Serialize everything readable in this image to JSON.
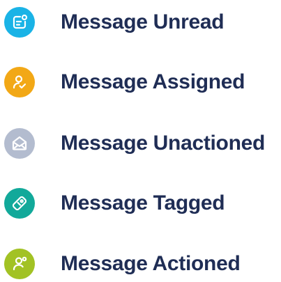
{
  "legend": {
    "items": [
      {
        "label": "Message Unread",
        "icon": "message-unread-icon",
        "color": "#1ab3e6"
      },
      {
        "label": "Message Assigned",
        "icon": "user-check-icon",
        "color": "#f2a816"
      },
      {
        "label": "Message Unactioned",
        "icon": "open-envelope-icon",
        "color": "#b3bccf"
      },
      {
        "label": "Message Tagged",
        "icon": "tag-icon",
        "color": "#12a99a"
      },
      {
        "label": "Message Actioned",
        "icon": "user-actioned-icon",
        "color": "#a2c224"
      }
    ],
    "text_color": "#1f2d55"
  }
}
